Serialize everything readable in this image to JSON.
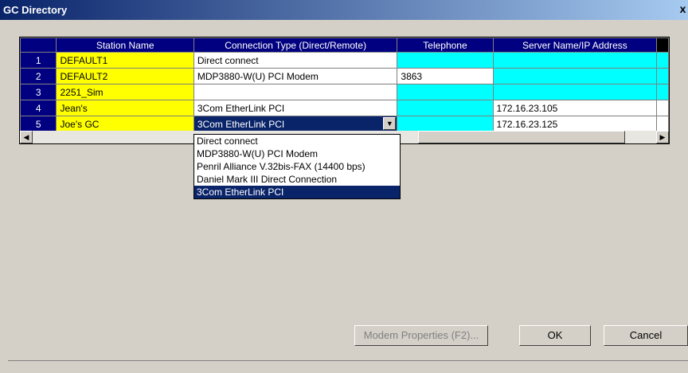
{
  "window": {
    "title": "GC Directory",
    "close_glyph": "x"
  },
  "table": {
    "headers": [
      "Station Name",
      "Connection Type (Direct/Remote)",
      "Telephone",
      "Server Name/IP Address"
    ],
    "rows": [
      {
        "num": "1",
        "station": "DEFAULT1",
        "connection": "Direct connect",
        "telephone": "",
        "server": ""
      },
      {
        "num": "2",
        "station": "DEFAULT2",
        "connection": "MDP3880-W(U) PCI Modem",
        "telephone": "3863",
        "server": ""
      },
      {
        "num": "3",
        "station": "2251_Sim",
        "connection": "",
        "telephone": "",
        "server": ""
      },
      {
        "num": "4",
        "station": "Jean's",
        "connection": "3Com EtherLink PCI",
        "telephone": "",
        "server": "172.16.23.105"
      },
      {
        "num": "5",
        "station": "Joe's GC",
        "connection": "3Com EtherLink PCI",
        "telephone": "",
        "server": "172.16.23.125"
      }
    ]
  },
  "dropdown": {
    "options": [
      "Direct connect",
      "MDP3880-W(U) PCI Modem",
      "Penril Alliance V.32bis-FAX (14400 bps)",
      "Daniel Mark III Direct Connection",
      "3Com EtherLink PCI"
    ],
    "selected": "3Com EtherLink PCI"
  },
  "buttons": {
    "modem_properties": "Modem Properties (F2)...",
    "ok": "OK",
    "cancel": "Cancel"
  },
  "colors": {
    "station_cell": "#ffff00",
    "empty_cell": "#00ffff",
    "header": "#000080",
    "selection": "#0a246a"
  },
  "icons": {
    "dropdown_arrow": "▼",
    "scroll_left": "◀",
    "scroll_right": "▶"
  }
}
